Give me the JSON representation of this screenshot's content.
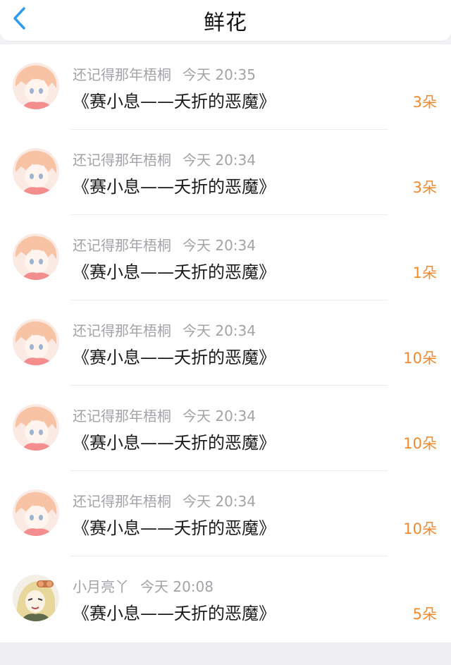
{
  "header": {
    "title": "鲜花",
    "back_icon": "chevron-left-icon",
    "accent": "#2d9cf0"
  },
  "colors": {
    "count": "#f28a2e",
    "meta": "#a3a3a8"
  },
  "entries": [
    {
      "user": "还记得那年梧桐",
      "time": "今天 20:35",
      "title": "《赛小息——夭折的恶魔》",
      "count": "3朵",
      "avatar": "anime-girl-orange-avatar"
    },
    {
      "user": "还记得那年梧桐",
      "time": "今天 20:34",
      "title": "《赛小息——夭折的恶魔》",
      "count": "3朵",
      "avatar": "anime-girl-orange-avatar"
    },
    {
      "user": "还记得那年梧桐",
      "time": "今天 20:34",
      "title": "《赛小息——夭折的恶魔》",
      "count": "1朵",
      "avatar": "anime-girl-orange-avatar"
    },
    {
      "user": "还记得那年梧桐",
      "time": "今天 20:34",
      "title": "《赛小息——夭折的恶魔》",
      "count": "10朵",
      "avatar": "anime-girl-orange-avatar"
    },
    {
      "user": "还记得那年梧桐",
      "time": "今天 20:34",
      "title": "《赛小息——夭折的恶魔》",
      "count": "10朵",
      "avatar": "anime-girl-orange-avatar"
    },
    {
      "user": "还记得那年梧桐",
      "time": "今天 20:34",
      "title": "《赛小息——夭折的恶魔》",
      "count": "10朵",
      "avatar": "anime-girl-orange-avatar"
    },
    {
      "user": "小月亮丫",
      "time": "今天 20:08",
      "title": "《赛小息——夭折的恶魔》",
      "count": "5朵",
      "avatar": "anime-blonde-goggles-avatar"
    }
  ]
}
